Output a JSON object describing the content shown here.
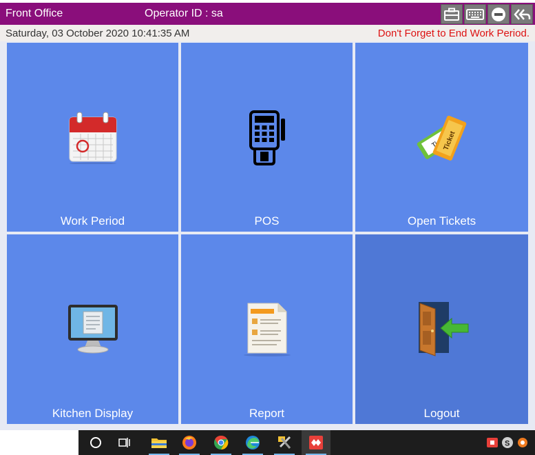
{
  "header": {
    "title": "Front Office",
    "operator": "Operator ID :  sa",
    "buttons": [
      "briefcase-icon",
      "keyboard-icon",
      "minimize-icon",
      "back-icon"
    ]
  },
  "status": {
    "datetime": "Saturday, 03 October 2020 10:41:35 AM",
    "warning": "Don't Forget to End Work Period."
  },
  "tiles": [
    {
      "label": "Work Period",
      "icon": "calendar-icon"
    },
    {
      "label": "POS",
      "icon": "pos-terminal-icon"
    },
    {
      "label": "Open Tickets",
      "icon": "tickets-icon"
    },
    {
      "label": "Kitchen Display",
      "icon": "monitor-icon"
    },
    {
      "label": "Report",
      "icon": "report-icon"
    },
    {
      "label": "Logout",
      "icon": "exit-door-icon"
    }
  ],
  "taskbar": {
    "items": [
      "cortana-icon",
      "task-view-icon",
      "file-explorer-icon",
      "firefox-icon",
      "chrome-icon",
      "edge-icon",
      "tools-icon",
      "anydesk-icon"
    ],
    "tray": [
      "red-app-icon",
      "skype-icon",
      "tray-app-icon"
    ]
  },
  "colors": {
    "header": "#8a0e7b",
    "tile": "#5c88ea",
    "tile_selected": "#4f78d6",
    "warning": "#dd1111"
  }
}
